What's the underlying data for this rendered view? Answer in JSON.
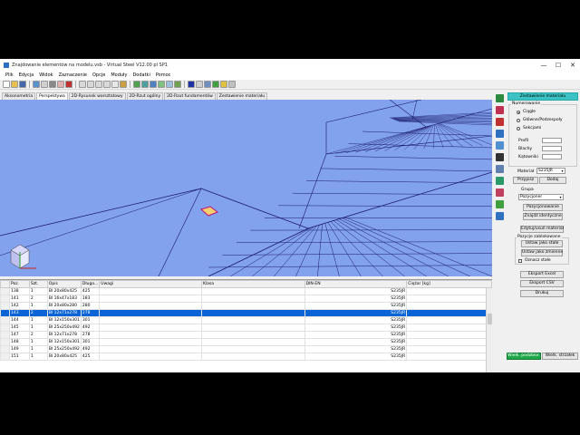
{
  "window": {
    "title": "Znajdowanie elementów na modelu.vsb - Virtual Steel V12.00 pl SP1",
    "controls": [
      "—",
      "☐",
      "✕"
    ]
  },
  "menu": [
    "Plik",
    "Edycja",
    "Widok",
    "Zaznaczenie",
    "Opcje",
    "Moduły",
    "Dodatki",
    "Pomoc"
  ],
  "tabs": [
    {
      "label": "Aksonometria",
      "active": false
    },
    {
      "label": "Perspektywa",
      "active": true
    },
    {
      "label": "2D-Rysunek warsztatowy",
      "active": false
    },
    {
      "label": "2D-Rzut ogólny",
      "active": false
    },
    {
      "label": "2D-Rzut fundamentów",
      "active": false
    },
    {
      "label": "Zestawienie materiału",
      "active": false
    }
  ],
  "grid": {
    "columns": [
      "Poz.",
      "Szt.",
      "Opis",
      "Długo...",
      "Uwagi",
      "Klasa",
      "DIN-EN",
      "Ciężar [kg]"
    ],
    "rows": [
      [
        "138",
        "1",
        "Bl 20x80x425",
        "425",
        "",
        "",
        "S235JR",
        ""
      ],
      [
        "141",
        "2",
        "Bl 16x47x183",
        "183",
        "",
        "",
        "S235JR",
        ""
      ],
      [
        "142",
        "1",
        "Bl 20x80x280",
        "280",
        "",
        "",
        "S235JR",
        ""
      ],
      [
        "143",
        "2",
        "Bl 12x71x278",
        "278",
        "",
        "",
        "S235JR",
        ""
      ],
      [
        "144",
        "1",
        "Bl 12x150x301",
        "301",
        "",
        "",
        "S235JR",
        ""
      ],
      [
        "145",
        "1",
        "Bl 25x250x492",
        "492",
        "",
        "",
        "S235JR",
        ""
      ],
      [
        "147",
        "2",
        "Bl 12x71x278",
        "278",
        "",
        "",
        "S235JR",
        ""
      ],
      [
        "148",
        "1",
        "Bl 12x150x301",
        "301",
        "",
        "",
        "S235JR",
        ""
      ],
      [
        "149",
        "1",
        "Bl 25x250x492",
        "492",
        "",
        "",
        "S235JR",
        ""
      ],
      [
        "151",
        "1",
        "Bl 20x80x425",
        "425",
        "",
        "",
        "S235JR",
        ""
      ]
    ],
    "selected_row": 3
  },
  "panel": {
    "header_button": "Zestawienie materiału",
    "numbering_label": "Numerowanie",
    "radio_continuous": "Ciągłe",
    "radio_by_subassembly": "Główne/Podzespoły",
    "radio_by_section": "Sekcjami",
    "label_profiles": "Profil",
    "label_plates": "Blachy",
    "label_angles": "Kątowniki",
    "material_label": "Materiał",
    "material_value": "S235JR",
    "assign_button": "Przypisz",
    "add_button": "Dodaj",
    "group_label": "Grupa",
    "group_value": "Pozycjoner",
    "positioning_button": "Pozycjonowanie",
    "find_identical_button": "Znajdź identyczne",
    "edit_material_button": "Edytuj/usuń materiał",
    "locked_positions_label": "Pozycje zablokowane",
    "set_fixed_button": "Ustaw jako stałe",
    "set_variable_button": "Ustaw jako zmienne",
    "mark_fixed_label": "Oznacz stałe",
    "export_excel_button": "Eksport Excel",
    "export_csv_button": "Eksport CSV",
    "print_button": "Drukuj",
    "big_parts_button": "Wielk. podzbior.",
    "big_items_button": "Wielk. strzałek"
  },
  "colors": {
    "viewport_bg": "#82a2ee",
    "selection": "#0a64d6",
    "wireframe": "#1a1a6a",
    "panel_header": "#3cc2c2"
  }
}
